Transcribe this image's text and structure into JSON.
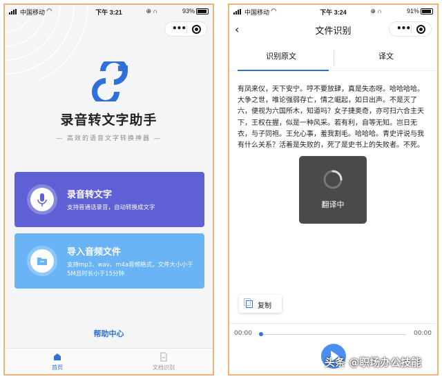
{
  "left_screen": {
    "status": {
      "carrier": "中国移动",
      "time": "下午 3:21",
      "battery": "93%",
      "battery_level": 0.93
    },
    "app_title": "录音转文字助手",
    "app_subtitle": "— 高效的语音文字转换神器 —",
    "cards": [
      {
        "title": "录音转文字",
        "desc": "支持普通话录音，自动转换成文字",
        "icon": "microphone-icon"
      },
      {
        "title": "导入音频文件",
        "desc": "支持mp3、wav、m4a音频格式，文件大小小于5M且时长小于15分钟",
        "icon": "folder-icon"
      }
    ],
    "help_link": "帮助中心",
    "tabbar": [
      {
        "label": "首页",
        "icon": "home-icon",
        "active": true
      },
      {
        "label": "文档识别",
        "icon": "document-icon",
        "active": false
      }
    ]
  },
  "right_screen": {
    "status": {
      "carrier": "中国移动",
      "time": "下午 3:24",
      "battery": "91%",
      "battery_level": 0.91
    },
    "nav_title": "文件识别",
    "tabs": [
      {
        "label": "识别原文",
        "active": true
      },
      {
        "label": "译文",
        "active": false
      }
    ],
    "body": "有凤来仪，天下安宁。哼不要放肆，真是失态呀。哈哈哈哈。大争之世，唯论强弱存亡，情之崛起，如日出声。不是灭了六，便视为六国所木，知道吗？女子捷奥奇，亦可扫六合主天下，王权在握，似是一种风采。若有利，自等无知。岂日无衣，与子同袍。王允心事，羞我割毛。哈哈哈。青史评说与我有什么关系？活着是失败的，死了是史书上的失败者。不死。",
    "toast": "翻译中",
    "copy_button": "复制",
    "player": {
      "current": "00:00",
      "total": "00:00",
      "progress": 0
    }
  },
  "watermark": "头条 @职场办公技能",
  "colors": {
    "accent": "#2f6fd9",
    "card_record": "#5f5fd6",
    "card_import": "#6ab4f6",
    "frame": "#f0b27a"
  }
}
